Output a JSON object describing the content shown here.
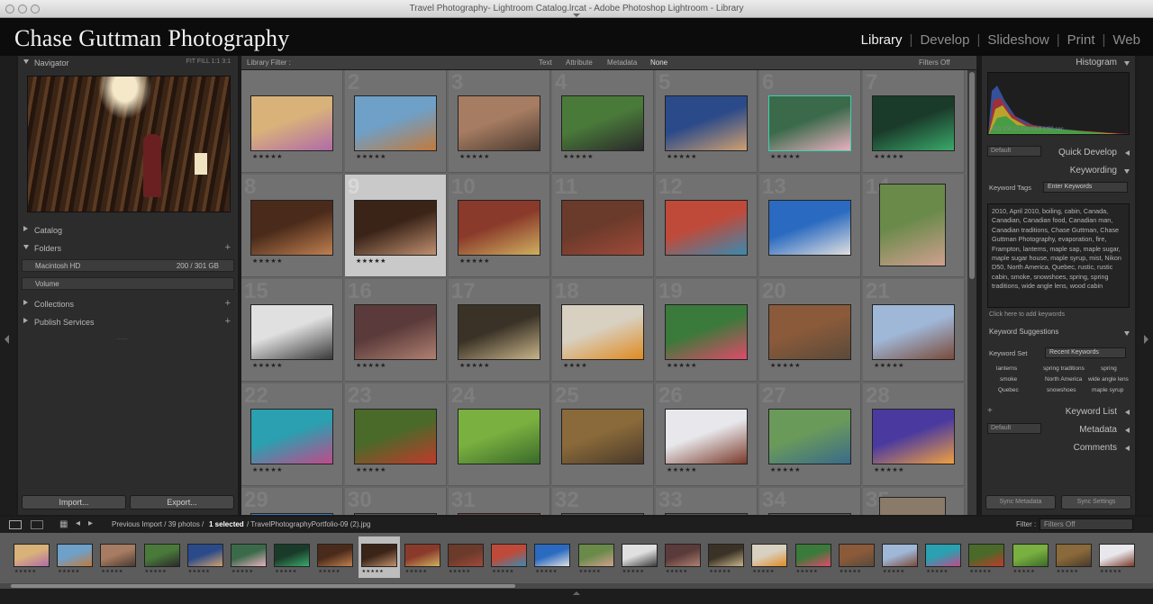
{
  "window": {
    "title": "Travel Photography- Lightroom Catalog.lrcat - Adobe Photoshop Lightroom - Library"
  },
  "identity_plate": "Chase Guttman Photography",
  "modules": [
    {
      "label": "Library",
      "active": true
    },
    {
      "label": "Develop",
      "active": false
    },
    {
      "label": "Slideshow",
      "active": false
    },
    {
      "label": "Print",
      "active": false
    },
    {
      "label": "Web",
      "active": false
    }
  ],
  "left_panel": {
    "navigator": {
      "title": "Navigator",
      "options": "FIT  FILL  1:1  3:1"
    },
    "catalog": "Catalog",
    "folders": "Folders",
    "folder_items": [
      {
        "name": "Macintosh HD",
        "info": "200 / 301 GB"
      },
      {
        "name": "Volume",
        "info": ""
      }
    ],
    "collections": "Collections",
    "publish_services": "Publish Services",
    "separator": "......",
    "import_label": "Import...",
    "export_label": "Export..."
  },
  "toolbar": {
    "title": "Library Filter :",
    "tabs": [
      "Text",
      "Attribute",
      "Metadata",
      "None"
    ],
    "filters": "Filters Off"
  },
  "grid_cells": [
    {
      "idx": "",
      "c1": "#d9b27a",
      "c2": "#b06aa8",
      "stars": "★★★★★"
    },
    {
      "idx": "2",
      "c1": "#6ea0c8",
      "c2": "#c27a3c",
      "stars": "★★★★★"
    },
    {
      "idx": "3",
      "c1": "#a67c62",
      "c2": "#4a3a30",
      "stars": "★★★★★"
    },
    {
      "idx": "4",
      "c1": "#4a7a3a",
      "c2": "#2a2a2a",
      "stars": "★★★★★"
    },
    {
      "idx": "5",
      "c1": "#2a4a8a",
      "c2": "#d0a070",
      "stars": "★★★★★"
    },
    {
      "idx": "6",
      "c1": "#3a6a4a",
      "c2": "#e8b0c0",
      "stars": "★★★★★"
    },
    {
      "idx": "7",
      "c1": "#1a3a2a",
      "c2": "#3aaa6a",
      "stars": "★★★★★"
    },
    {
      "idx": "8",
      "c1": "#4a2a1a",
      "c2": "#c08050",
      "stars": "★★★★★"
    },
    {
      "idx": "9",
      "c1": "#3a2418",
      "c2": "#c09070",
      "stars": "★★★★★"
    },
    {
      "idx": "10",
      "c1": "#8a3a2a",
      "c2": "#d0b060",
      "stars": "★★★★★"
    },
    {
      "idx": "11",
      "c1": "#6a3a2a",
      "c2": "#a04a3a",
      "stars": ""
    },
    {
      "idx": "12",
      "c1": "#c04a3a",
      "c2": "#3a8ab0",
      "stars": ""
    },
    {
      "idx": "13",
      "c1": "#2a6ac0",
      "c2": "#e0e0e0",
      "stars": ""
    },
    {
      "idx": "14",
      "c1": "#6a8a4a",
      "c2": "#d0a090",
      "stars": ""
    },
    {
      "idx": "15",
      "c1": "#e0e0e0",
      "c2": "#3a3a3a",
      "stars": "★★★★★"
    },
    {
      "idx": "16",
      "c1": "#5a3a3a",
      "c2": "#b08070",
      "stars": "★★★★★"
    },
    {
      "idx": "17",
      "c1": "#3a3226",
      "c2": "#c8b48a",
      "stars": "★★★★★"
    },
    {
      "idx": "18",
      "c1": "#d8d0c0",
      "c2": "#e08a20",
      "stars": "★★★★"
    },
    {
      "idx": "19",
      "c1": "#3a7a3a",
      "c2": "#e04a6a",
      "stars": "★★★★★"
    },
    {
      "idx": "20",
      "c1": "#8a5a3a",
      "c2": "#5a4a3a",
      "stars": "★★★★★"
    },
    {
      "idx": "21",
      "c1": "#a0b8d8",
      "c2": "#7a4a3a",
      "stars": "★★★★★"
    },
    {
      "idx": "22",
      "c1": "#2aa0b0",
      "c2": "#c04a8a",
      "stars": "★★★★★"
    },
    {
      "idx": "23",
      "c1": "#4a6a2a",
      "c2": "#c03a2a",
      "stars": "★★★★★"
    },
    {
      "idx": "24",
      "c1": "#7ab040",
      "c2": "#3a6a2a",
      "stars": ""
    },
    {
      "idx": "25",
      "c1": "#8a6a3a",
      "c2": "#4a3a2a",
      "stars": ""
    },
    {
      "idx": "26",
      "c1": "#e8e8ec",
      "c2": "#7a3a2a",
      "stars": "★★★★★"
    },
    {
      "idx": "27",
      "c1": "#6a9a5a",
      "c2": "#3a6a8a",
      "stars": "★★★★★"
    },
    {
      "idx": "28",
      "c1": "#4a3aa0",
      "c2": "#f0a040",
      "stars": "★★★★★"
    },
    {
      "idx": "29",
      "c1": "#3a7ab8",
      "c2": "#6a6a6a",
      "stars": ""
    },
    {
      "idx": "30",
      "c1": "#5a5a5a",
      "c2": "#5a5a5a",
      "stars": ""
    },
    {
      "idx": "31",
      "c1": "#6a4a3a",
      "c2": "#4a4a4a",
      "stars": ""
    },
    {
      "idx": "32",
      "c1": "#5a5a5a",
      "c2": "#5a5a5a",
      "stars": ""
    },
    {
      "idx": "33",
      "c1": "#5a5a5a",
      "c2": "#5a5a5a",
      "stars": ""
    },
    {
      "idx": "34",
      "c1": "#5a5a5a",
      "c2": "#5a5a5a",
      "stars": ""
    },
    {
      "idx": "35",
      "c1": "#8a7a6a",
      "c2": "#6a5a4a",
      "stars": ""
    }
  ],
  "right_panel": {
    "histogram": "Histogram",
    "histogram_info": "ISO 100    12 mm    f/2.8    1/60 sec",
    "quick_develop": "Quick Develop",
    "quick_develop_preset": "Default",
    "keywording": "Keywording",
    "keyword_tags_label": "Keyword Tags",
    "keyword_tags_mode": "Enter Keywords",
    "keyword_tags": "2010, April 2010, boiling, cabin, Canada, Canadian, Canadian food, Canadian man, Canadian traditions, Chase Guttman, Chase Guttman Photography, evaporation, fire, Frampton, lanterns, maple sap, maple sugar, maple sugar house, maple syrup, mist, Nikon D50, North America, Quebec, rustic, rustic cabin, smoke, snowshoes, spring, spring traditions, wide angle lens, wood cabin",
    "click_here": "Click here to add keywords",
    "keyword_suggestions": "Keyword Suggestions",
    "keyword_set_label": "Keyword Set",
    "keyword_set_value": "Recent Keywords",
    "keyword_set": [
      "lanterns",
      "spring traditions",
      "spring",
      "smoke",
      "North America",
      "wide angle lens",
      "Quebec",
      "snowshoes",
      "maple syrup"
    ],
    "keyword_list": "Keyword List",
    "metadata": "Metadata",
    "metadata_preset": "Default",
    "comments": "Comments",
    "sync_metadata": "Sync Metadata",
    "sync_settings": "Sync Settings"
  },
  "filmstrip_bar": {
    "source": "Previous Import / 39 photos /",
    "selected": "1 selected",
    "file": "/ TravelPhotographyPortfolio-09 (2).jpg",
    "filter_label": "Filter :",
    "filter_value": "Filters Off"
  },
  "filmstrip": [
    {
      "c1": "#d9b27a",
      "c2": "#b06aa8"
    },
    {
      "c1": "#6ea0c8",
      "c2": "#c27a3c"
    },
    {
      "c1": "#a67c62",
      "c2": "#4a3a30"
    },
    {
      "c1": "#4a7a3a",
      "c2": "#2a2a2a"
    },
    {
      "c1": "#2a4a8a",
      "c2": "#d0a070"
    },
    {
      "c1": "#3a6a4a",
      "c2": "#e8b0c0"
    },
    {
      "c1": "#1a3a2a",
      "c2": "#3aaa6a"
    },
    {
      "c1": "#4a2a1a",
      "c2": "#c08050"
    },
    {
      "c1": "#3a2418",
      "c2": "#c09070"
    },
    {
      "c1": "#8a3a2a",
      "c2": "#d0b060"
    },
    {
      "c1": "#6a3a2a",
      "c2": "#a04a3a"
    },
    {
      "c1": "#c04a3a",
      "c2": "#3a8ab0"
    },
    {
      "c1": "#2a6ac0",
      "c2": "#e0e0e0"
    },
    {
      "c1": "#6a8a4a",
      "c2": "#d0a090"
    },
    {
      "c1": "#e0e0e0",
      "c2": "#3a3a3a"
    },
    {
      "c1": "#5a3a3a",
      "c2": "#b08070"
    },
    {
      "c1": "#3a3226",
      "c2": "#c8b48a"
    },
    {
      "c1": "#d8d0c0",
      "c2": "#e08a20"
    },
    {
      "c1": "#3a7a3a",
      "c2": "#e04a6a"
    },
    {
      "c1": "#8a5a3a",
      "c2": "#5a4a3a"
    },
    {
      "c1": "#a0b8d8",
      "c2": "#7a4a3a"
    },
    {
      "c1": "#2aa0b0",
      "c2": "#c04a8a"
    },
    {
      "c1": "#4a6a2a",
      "c2": "#c03a2a"
    },
    {
      "c1": "#7ab040",
      "c2": "#3a6a2a"
    },
    {
      "c1": "#8a6a3a",
      "c2": "#4a3a2a"
    },
    {
      "c1": "#e8e8ec",
      "c2": "#7a3a2a"
    }
  ]
}
